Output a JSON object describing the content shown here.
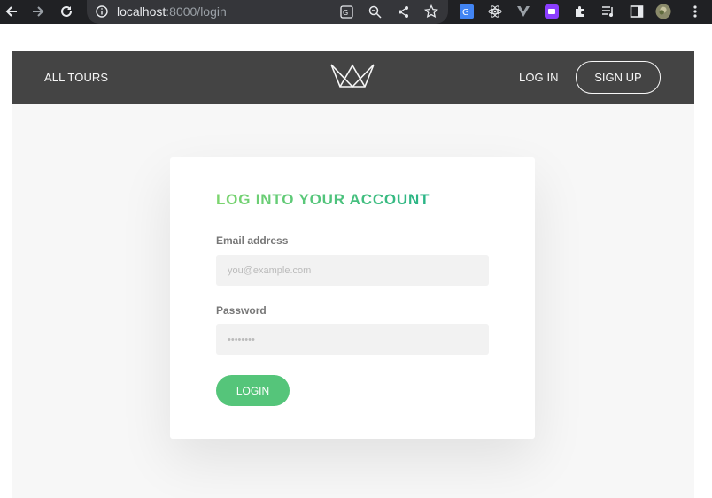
{
  "browser": {
    "url_host": "localhost",
    "url_rest": ":8000/login"
  },
  "nav": {
    "all_tours": "All tours",
    "log_in": "Log in",
    "sign_up": "Sign up"
  },
  "login_form": {
    "title": "LOG INTO YOUR ACCOUNT",
    "email_label": "Email address",
    "email_placeholder": "you@example.com",
    "password_label": "Password",
    "password_placeholder": "••••••••",
    "submit_label": "Login"
  },
  "colors": {
    "nav_bg": "#444444",
    "page_bg": "#f7f7f7",
    "accent_green": "#55c57a",
    "title_gradient_start": "#7dd56f",
    "title_gradient_end": "#28b487"
  }
}
